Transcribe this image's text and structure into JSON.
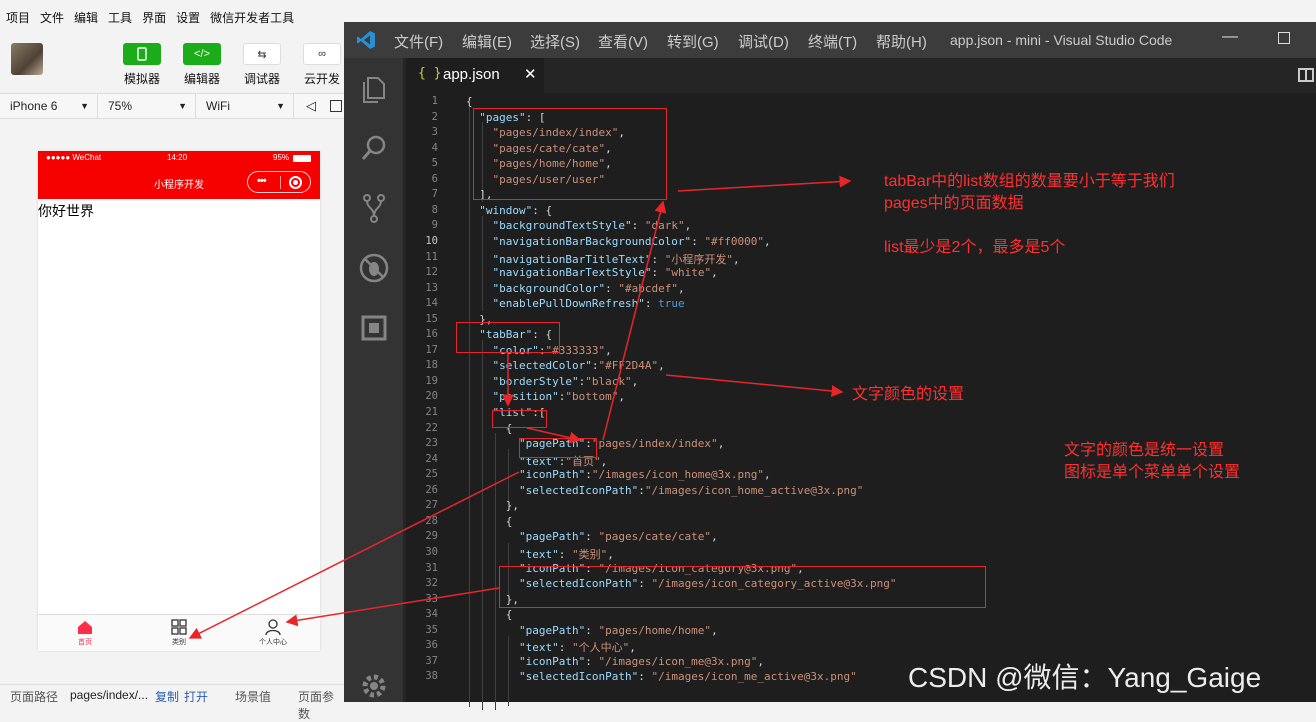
{
  "devtools": {
    "menu": [
      "项目",
      "文件",
      "编辑",
      "工具",
      "界面",
      "设置",
      "微信开发者工具"
    ],
    "tools": [
      {
        "label": "模拟器",
        "icon": "phone-icon",
        "color": "#1aad19"
      },
      {
        "label": "编辑器",
        "icon": "code-icon",
        "color": "#1aad19"
      },
      {
        "label": "调试器",
        "icon": "debug-icon",
        "color": "#ffffff"
      },
      {
        "label": "云开发",
        "icon": "cloud-icon",
        "color": "#ffffff"
      }
    ],
    "device": "iPhone 6",
    "zoom": "75%",
    "network": "WiFi",
    "footer": {
      "path_label": "页面路径",
      "path_value": "pages/index/...",
      "copy": "复制",
      "open": "打开",
      "scene": "场景值",
      "params": "页面参数"
    }
  },
  "phone": {
    "carrier": "●●●●● WeChat",
    "time": "14:20",
    "battery": "95%",
    "nav_title": "小程序开发",
    "nav_color": "#ff0000",
    "content_text": "你好世界",
    "tabs": [
      {
        "label": "首页",
        "icon": "home-icon",
        "active": true
      },
      {
        "label": "类别",
        "icon": "category-icon",
        "active": false
      },
      {
        "label": "个人中心",
        "icon": "user-icon",
        "active": false
      }
    ]
  },
  "vscode": {
    "menu": [
      "文件(F)",
      "编辑(E)",
      "选择(S)",
      "查看(V)",
      "转到(G)",
      "调试(D)",
      "终端(T)",
      "帮助(H)"
    ],
    "window_title": "app.json - mini - Visual Studio Code",
    "tab_name": "app.json",
    "tab_bracket": "{ }",
    "current_line": 10,
    "code_lines": [
      {
        "n": "1",
        "text": "{"
      },
      {
        "n": "2",
        "text": "  \"pages\": ["
      },
      {
        "n": "3",
        "text": "    \"pages/index/index\","
      },
      {
        "n": "4",
        "text": "    \"pages/cate/cate\","
      },
      {
        "n": "5",
        "text": "    \"pages/home/home\","
      },
      {
        "n": "6",
        "text": "    \"pages/user/user\""
      },
      {
        "n": "7",
        "text": "  ],"
      },
      {
        "n": "8",
        "text": "  \"window\": {"
      },
      {
        "n": "9",
        "text": "    \"backgroundTextStyle\": \"dark\","
      },
      {
        "n": "10",
        "text": "    \"navigationBarBackgroundColor\": \"#ff0000\","
      },
      {
        "n": "11",
        "text": "    \"navigationBarTitleText\": \"小程序开发\","
      },
      {
        "n": "12",
        "text": "    \"navigationBarTextStyle\": \"white\","
      },
      {
        "n": "13",
        "text": "    \"backgroundColor\": \"#abcdef\","
      },
      {
        "n": "14",
        "text": "    \"enablePullDownRefresh\": true"
      },
      {
        "n": "15",
        "text": "  },"
      },
      {
        "n": "16",
        "text": "  \"tabBar\": {"
      },
      {
        "n": "17",
        "text": "    \"color\":\"#333333\","
      },
      {
        "n": "18",
        "text": "    \"selectedColor\":\"#FF2D4A\","
      },
      {
        "n": "19",
        "text": "    \"borderStyle\":\"black\","
      },
      {
        "n": "20",
        "text": "    \"position\":\"bottom\","
      },
      {
        "n": "21",
        "text": "    \"list\":["
      },
      {
        "n": "22",
        "text": "      {"
      },
      {
        "n": "23",
        "text": "        \"pagePath\":\"pages/index/index\","
      },
      {
        "n": "24",
        "text": "        \"text\":\"首页\","
      },
      {
        "n": "25",
        "text": "        \"iconPath\":\"/images/icon_home@3x.png\","
      },
      {
        "n": "26",
        "text": "        \"selectedIconPath\":\"/images/icon_home_active@3x.png\""
      },
      {
        "n": "27",
        "text": "      },"
      },
      {
        "n": "28",
        "text": "      {"
      },
      {
        "n": "29",
        "text": "        \"pagePath\": \"pages/cate/cate\","
      },
      {
        "n": "30",
        "text": "        \"text\": \"类别\","
      },
      {
        "n": "31",
        "text": "        \"iconPath\": \"/images/icon_category@3x.png\","
      },
      {
        "n": "32",
        "text": "        \"selectedIconPath\": \"/images/icon_category_active@3x.png\""
      },
      {
        "n": "33",
        "text": "      },"
      },
      {
        "n": "34",
        "text": "      {"
      },
      {
        "n": "35",
        "text": "        \"pagePath\": \"pages/home/home\","
      },
      {
        "n": "36",
        "text": "        \"text\": \"个人中心\","
      },
      {
        "n": "37",
        "text": "        \"iconPath\": \"/images/icon_me@3x.png\","
      },
      {
        "n": "38",
        "text": "        \"selectedIconPath\": \"/images/icon_me_active@3x.png\""
      }
    ]
  },
  "annotations": {
    "pages_note_1": "tabBar中的list数组的数量要小于等于我们",
    "pages_note_2": "pages中的页面数据",
    "list_note": "list最少是2个，最多是5个",
    "color_note": "文字颜色的设置",
    "icon_note_1": "文字的颜色是统一设置",
    "icon_note_2": "图标是单个菜单单个设置",
    "annotation_color": "#ff2020"
  },
  "watermark": "CSDN @微信：Yang_Gaige"
}
